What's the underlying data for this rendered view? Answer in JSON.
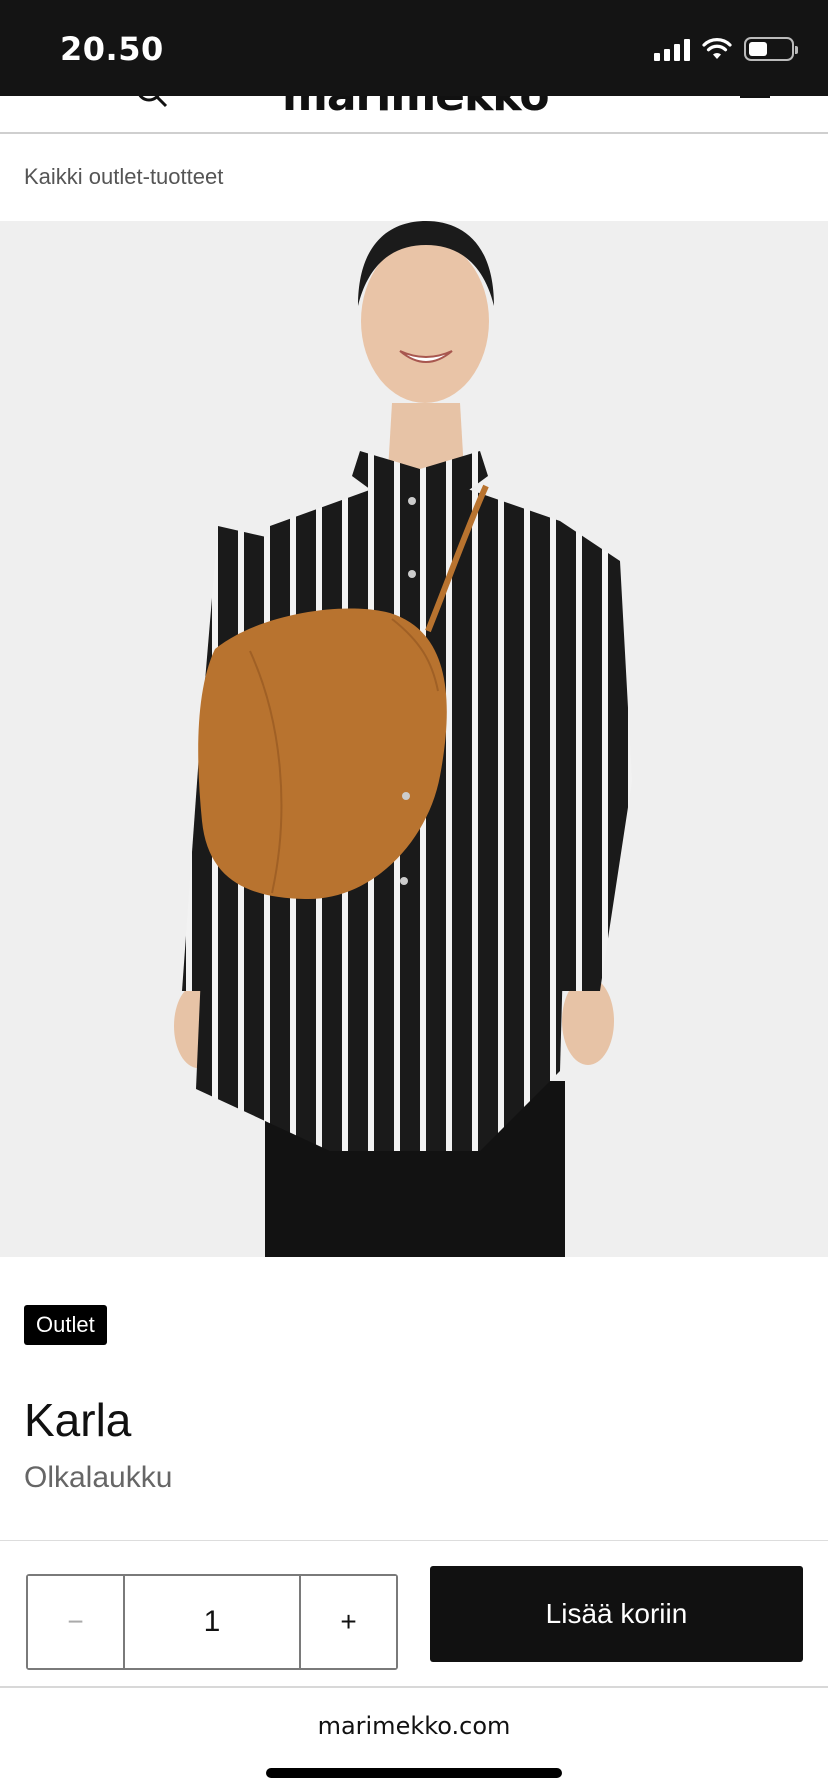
{
  "status_bar": {
    "time": "20.50"
  },
  "header": {
    "logo_text": "marimekko"
  },
  "breadcrumb": {
    "label": "Kaikki outlet-tuotteet"
  },
  "product": {
    "badge": "Outlet",
    "name": "Karla",
    "type": "Olkalaukku",
    "image_alt": "Karla Olkalaukku"
  },
  "cart": {
    "minus_label": "−",
    "quantity": "1",
    "plus_label": "+",
    "add_label": "Lisää koriin"
  },
  "browser": {
    "url": "marimekko.com"
  },
  "colors": {
    "bag": "#b8732f",
    "shirt_dark": "#1a1a1a",
    "background": "#efefef",
    "button": "#111111"
  }
}
